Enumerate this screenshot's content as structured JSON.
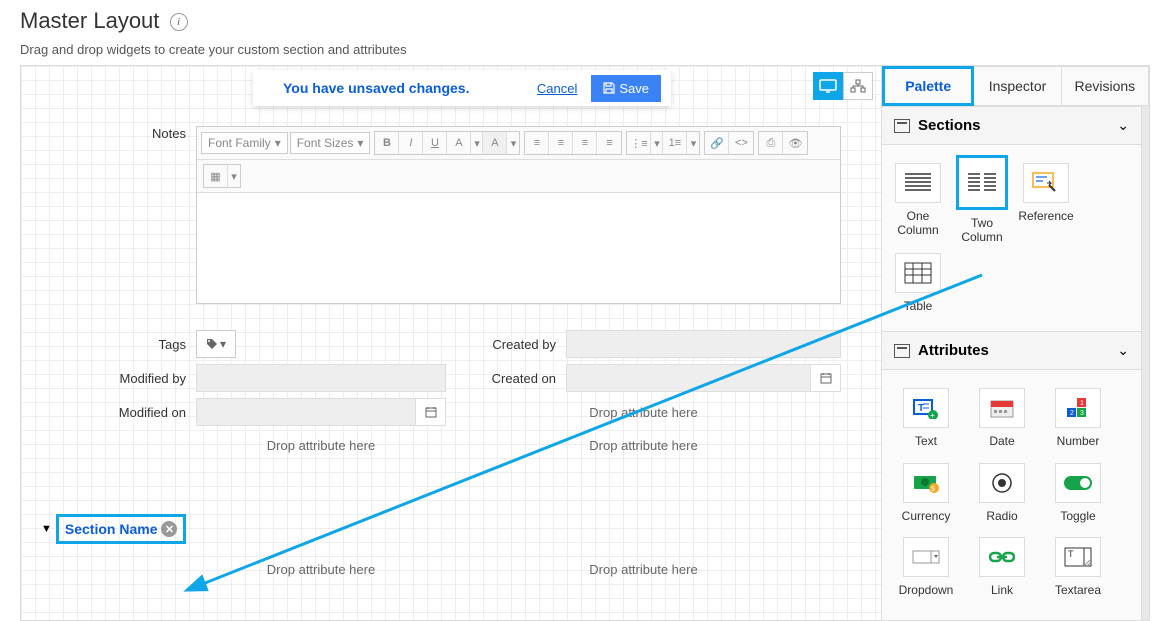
{
  "page": {
    "title": "Master Layout",
    "subtitle": "Drag and drop widgets to create your custom section and attributes"
  },
  "unsaved": {
    "message": "You have unsaved changes.",
    "cancel": "Cancel",
    "save": "Save"
  },
  "form": {
    "notes_label": "Notes",
    "tags_label": "Tags",
    "created_by_label": "Created by",
    "modified_by_label": "Modified by",
    "created_on_label": "Created on",
    "modified_on_label": "Modified on",
    "drop_hint": "Drop attribute here"
  },
  "rte": {
    "font_family": "Font Family",
    "font_sizes": "Font Sizes"
  },
  "section": {
    "name": "Section Name"
  },
  "sidebar": {
    "tabs": {
      "palette": "Palette",
      "inspector": "Inspector",
      "revisions": "Revisions"
    },
    "sections": {
      "title": "Sections",
      "items": {
        "one_column": "One Column",
        "two_column": "Two Column",
        "reference": "Reference",
        "table": "Table"
      }
    },
    "attributes": {
      "title": "Attributes",
      "items": {
        "text": "Text",
        "date": "Date",
        "number": "Number",
        "currency": "Currency",
        "radio": "Radio",
        "toggle": "Toggle",
        "dropdown": "Dropdown",
        "link": "Link",
        "textarea": "Textarea"
      }
    }
  }
}
